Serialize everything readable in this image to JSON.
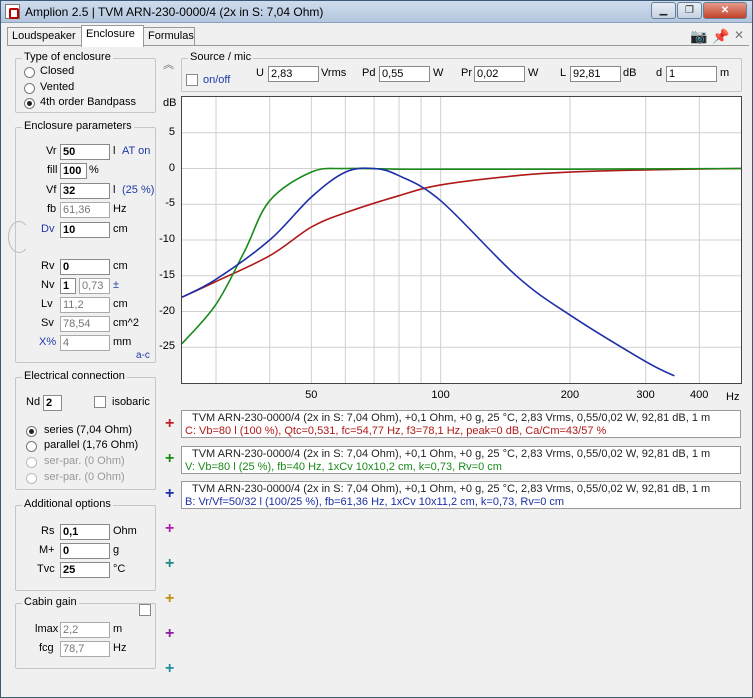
{
  "window": {
    "title": "Amplion 2.5 | TVM ARN-230-0000/4 (2x in S: 7,04 Ohm)",
    "buttons": [
      "▁",
      "❐",
      "✕"
    ]
  },
  "tabs": [
    "Loudspeaker",
    "Enclosure",
    "Formulas"
  ],
  "enclosure_type": {
    "title": "Type of enclosure",
    "options": [
      "Closed",
      "Vented",
      "4th order Bandpass"
    ],
    "selected": 2
  },
  "params": {
    "title": "Enclosure parameters",
    "vr_label": "Vr",
    "vr": "50",
    "vr_unit": "l",
    "at_on": "AT on",
    "fill_label": "fill",
    "fill": "100",
    "fill_unit": "%",
    "vf_label": "Vf",
    "vf": "32",
    "vf_unit": "l",
    "vf_pct": "(25 %)",
    "fb_label": "fb",
    "fb": "61,36",
    "fb_unit": "Hz",
    "dv_label": "Dv",
    "dv": "10",
    "dv_unit": "cm",
    "rv_label": "Rv",
    "rv": "0",
    "rv_unit": "cm",
    "nv_label": "Nv",
    "nv": "1",
    "nv_k": "0,73",
    "nv_pm": "±",
    "lv_label": "Lv",
    "lv": "11,2",
    "lv_unit": "cm",
    "sv_label": "Sv",
    "sv": "78,54",
    "sv_unit": "cm^2",
    "xp_label": "X%",
    "xp": "4",
    "xp_unit": "mm",
    "ac": "a-c"
  },
  "electrical": {
    "title": "Electrical connection",
    "nd_label": "Nd",
    "nd": "2",
    "isobaric": "isobaric",
    "options": [
      "series (7,04 Ohm)",
      "parallel (1,76 Ohm)",
      "ser-par. (0 Ohm)",
      "ser-par. (0 Ohm)"
    ],
    "selected": 0
  },
  "additional": {
    "title": "Additional options",
    "rs_label": "Rs",
    "rs": "0,1",
    "rs_unit": "Ohm",
    "m_label": "M+",
    "m": "0",
    "m_unit": "g",
    "tvc_label": "Tvc",
    "tvc": "25",
    "tvc_unit": "°C"
  },
  "cabin": {
    "title": "Cabin gain",
    "lmax_label": "lmax",
    "lmax": "2,2",
    "lmax_unit": "m",
    "fcg_label": "fcg",
    "fcg": "78,7",
    "fcg_unit": "Hz"
  },
  "source": {
    "title": "Source / mic",
    "onoff": "on/off",
    "u_label": "U",
    "u": "2,83",
    "u_unit": "Vrms",
    "pd_label": "Pd",
    "pd": "0,55",
    "pd_unit": "W",
    "pr_label": "Pr",
    "pr": "0,02",
    "pr_unit": "W",
    "l_label": "L",
    "l": "92,81",
    "l_unit": "dB",
    "d_label": "d",
    "d": "1",
    "d_unit": "m"
  },
  "chart_data": {
    "type": "line",
    "ylabel": "dB",
    "xlabel": "Hz",
    "x_scale": "log",
    "xlim": [
      25,
      500
    ],
    "ylim": [
      -30,
      10
    ],
    "yticks": [
      5,
      0,
      -5,
      -10,
      -15,
      -20,
      -25
    ],
    "xticks": [
      50,
      100,
      200,
      300,
      400
    ],
    "grid": true,
    "series": [
      {
        "color": "#b01818",
        "x": [
          25,
          30,
          40,
          50,
          60,
          80,
          100,
          150,
          200,
          300,
          500
        ],
        "y": [
          -18,
          -15.8,
          -12.2,
          -8.2,
          -6.2,
          -3.8,
          -2.3,
          -1.0,
          -0.5,
          -0.2,
          0
        ]
      },
      {
        "color": "#1a8a1a",
        "x": [
          25,
          30,
          35,
          40,
          50,
          60,
          80,
          100,
          200,
          500
        ],
        "y": [
          -24.5,
          -19,
          -11.5,
          -4.5,
          -0.5,
          0,
          -0.1,
          -0.1,
          -0.1,
          0
        ]
      },
      {
        "color": "#1c2fa8",
        "x": [
          25,
          30,
          40,
          50,
          60,
          70,
          80,
          100,
          150,
          200,
          300,
          350
        ],
        "y": [
          -18,
          -15.5,
          -10,
          -4,
          -0.5,
          0,
          -1,
          -4.5,
          -15,
          -20.5,
          -27,
          -29
        ]
      }
    ]
  },
  "legend": [
    {
      "line1": "TVM ARN-230-0000/4 (2x in S: 7,04 Ohm), +0,1 Ohm, +0 g, 25 °C, 2,83 Vrms, 0,55/0,02 W, 92,81 dB, 1 m",
      "line2": "C: Vb=80 l (100 %), Qtc=0,531, fc=54,77 Hz, f3=78,1 Hz, peak=0 dB, Ca/Cm=43/57 %",
      "color": "#b01818"
    },
    {
      "line1": "TVM ARN-230-0000/4 (2x in S: 7,04 Ohm), +0,1 Ohm, +0 g, 25 °C, 2,83 Vrms, 0,55/0,02 W, 92,81 dB, 1 m",
      "line2": "V: Vb=80 l (25 %), fb=40 Hz, 1xCv 10x10,2 cm, k=0,73, Rv=0 cm",
      "color": "#1a8a1a"
    },
    {
      "line1": "TVM ARN-230-0000/4 (2x in S: 7,04 Ohm), +0,1 Ohm, +0 g, 25 °C, 2,83 Vrms, 0,55/0,02 W, 92,81 dB, 1 m",
      "line2": "B: Vr/Vf=50/32 l (100/25 %), fb=61,36 Hz, 1xCv 10x11,2 cm, k=0,73, Rv=0 cm",
      "color": "#1c2fa8"
    }
  ],
  "plus_colors": [
    "#c0202a",
    "#1a8a1a",
    "#1c2fa8",
    "#b020b0",
    "#208a8a",
    "#c09010",
    "#8a20a0",
    "#2090a0"
  ],
  "plus_symbol": "+"
}
